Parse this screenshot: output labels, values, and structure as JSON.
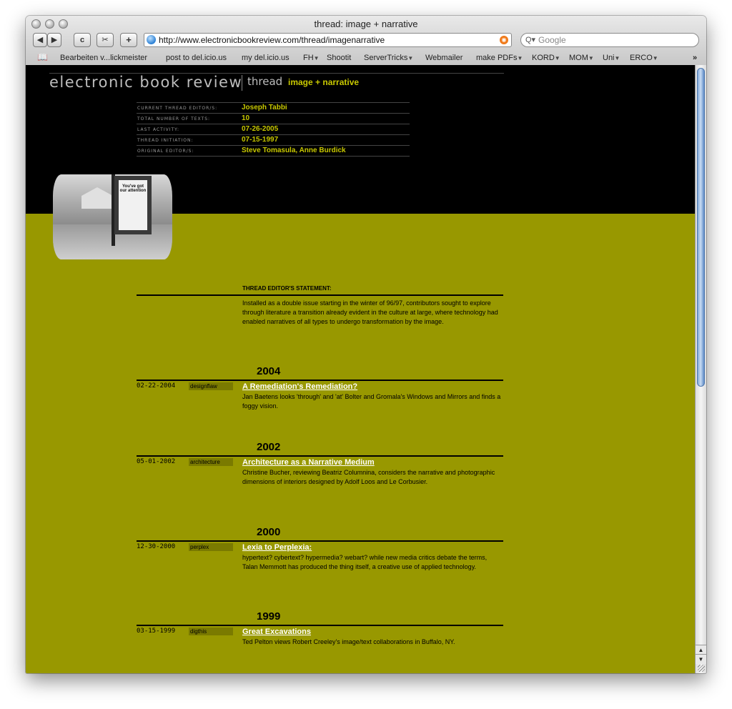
{
  "window": {
    "title": "thread: image + narrative"
  },
  "toolbar": {
    "back_label": "◀",
    "forward_label": "▶",
    "reload_label": "c",
    "snippet_label": "✂",
    "add_label": "+",
    "url": "http://www.electronicbookreview.com/thread/imagenarrative",
    "search_placeholder": "Google"
  },
  "bookmarks": [
    {
      "label": "Bearbeiten v...lickmeister",
      "menu": false
    },
    {
      "label": "post to del.icio.us",
      "menu": false
    },
    {
      "label": "my del.icio.us",
      "menu": false
    },
    {
      "label": "FH",
      "menu": true
    },
    {
      "label": "Shootit",
      "menu": false
    },
    {
      "label": "ServerTricks",
      "menu": true
    },
    {
      "label": "Webmailer",
      "menu": false
    },
    {
      "label": "make PDFs",
      "menu": true
    },
    {
      "label": "KORD",
      "menu": true
    },
    {
      "label": "MOM",
      "menu": true
    },
    {
      "label": "Uni",
      "menu": true
    },
    {
      "label": "ERCO",
      "menu": true
    }
  ],
  "site": {
    "logo": "electronic book review",
    "thread_word": "thread",
    "thread_name": "image + narrative"
  },
  "meta": [
    {
      "label": "current thread editor/s:",
      "value": "Joseph Tabbi"
    },
    {
      "label": "total number of texts:",
      "value": "10"
    },
    {
      "label": "last activity:",
      "value": "07-26-2005"
    },
    {
      "label": "thread initiation:",
      "value": "07-15-1997"
    },
    {
      "label": "original editor/s:",
      "value": "Steve Tomasula, Anne Burdick"
    }
  ],
  "photo": {
    "poster_text": "You've got our attention"
  },
  "statement": {
    "label": "THREAD EDITOR'S STATEMENT:",
    "text": "Installed as a double issue starting in the winter of 96/97, contributors sought to explore through literature a transition already evident in the culture at large, where technology had enabled narratives of all types to undergo transformation by the image."
  },
  "entries": [
    {
      "year": "2004",
      "date": "02-22-2004",
      "category": "designflaw",
      "title": "A Remediation's Remediation?",
      "desc": "Jan Baetens looks 'through' and 'at' Bolter and Gromala's Windows and Mirrors and finds a foggy vision."
    },
    {
      "year": "2002",
      "date": "05-01-2002",
      "category": "architecture",
      "title": "Architecture as a Narrative Medium",
      "desc": "Christine Bucher, reviewing Beatriz Columnina, considers the narrative and photographic dimensions of interiors designed by Adolf Loos and Le Corbusier."
    },
    {
      "year": "2000",
      "date": "12-30-2000",
      "category": "perplex",
      "title": "Lexia to Perplexia:",
      "desc": "hypertext? cybertext? hypermedia? webart? while new media critics debate the terms, Talan Memmott has produced the thing itself, a creative use of applied technology."
    },
    {
      "year": "1999",
      "date": "03-15-1999",
      "category": "digthis",
      "title": "Great Excavations",
      "desc": "Ted Pelton views Robert Creeley's image/text collaborations in Buffalo, NY."
    }
  ],
  "colors": {
    "olive": "#989800",
    "accent_text": "#c8c800",
    "black": "#000000"
  }
}
